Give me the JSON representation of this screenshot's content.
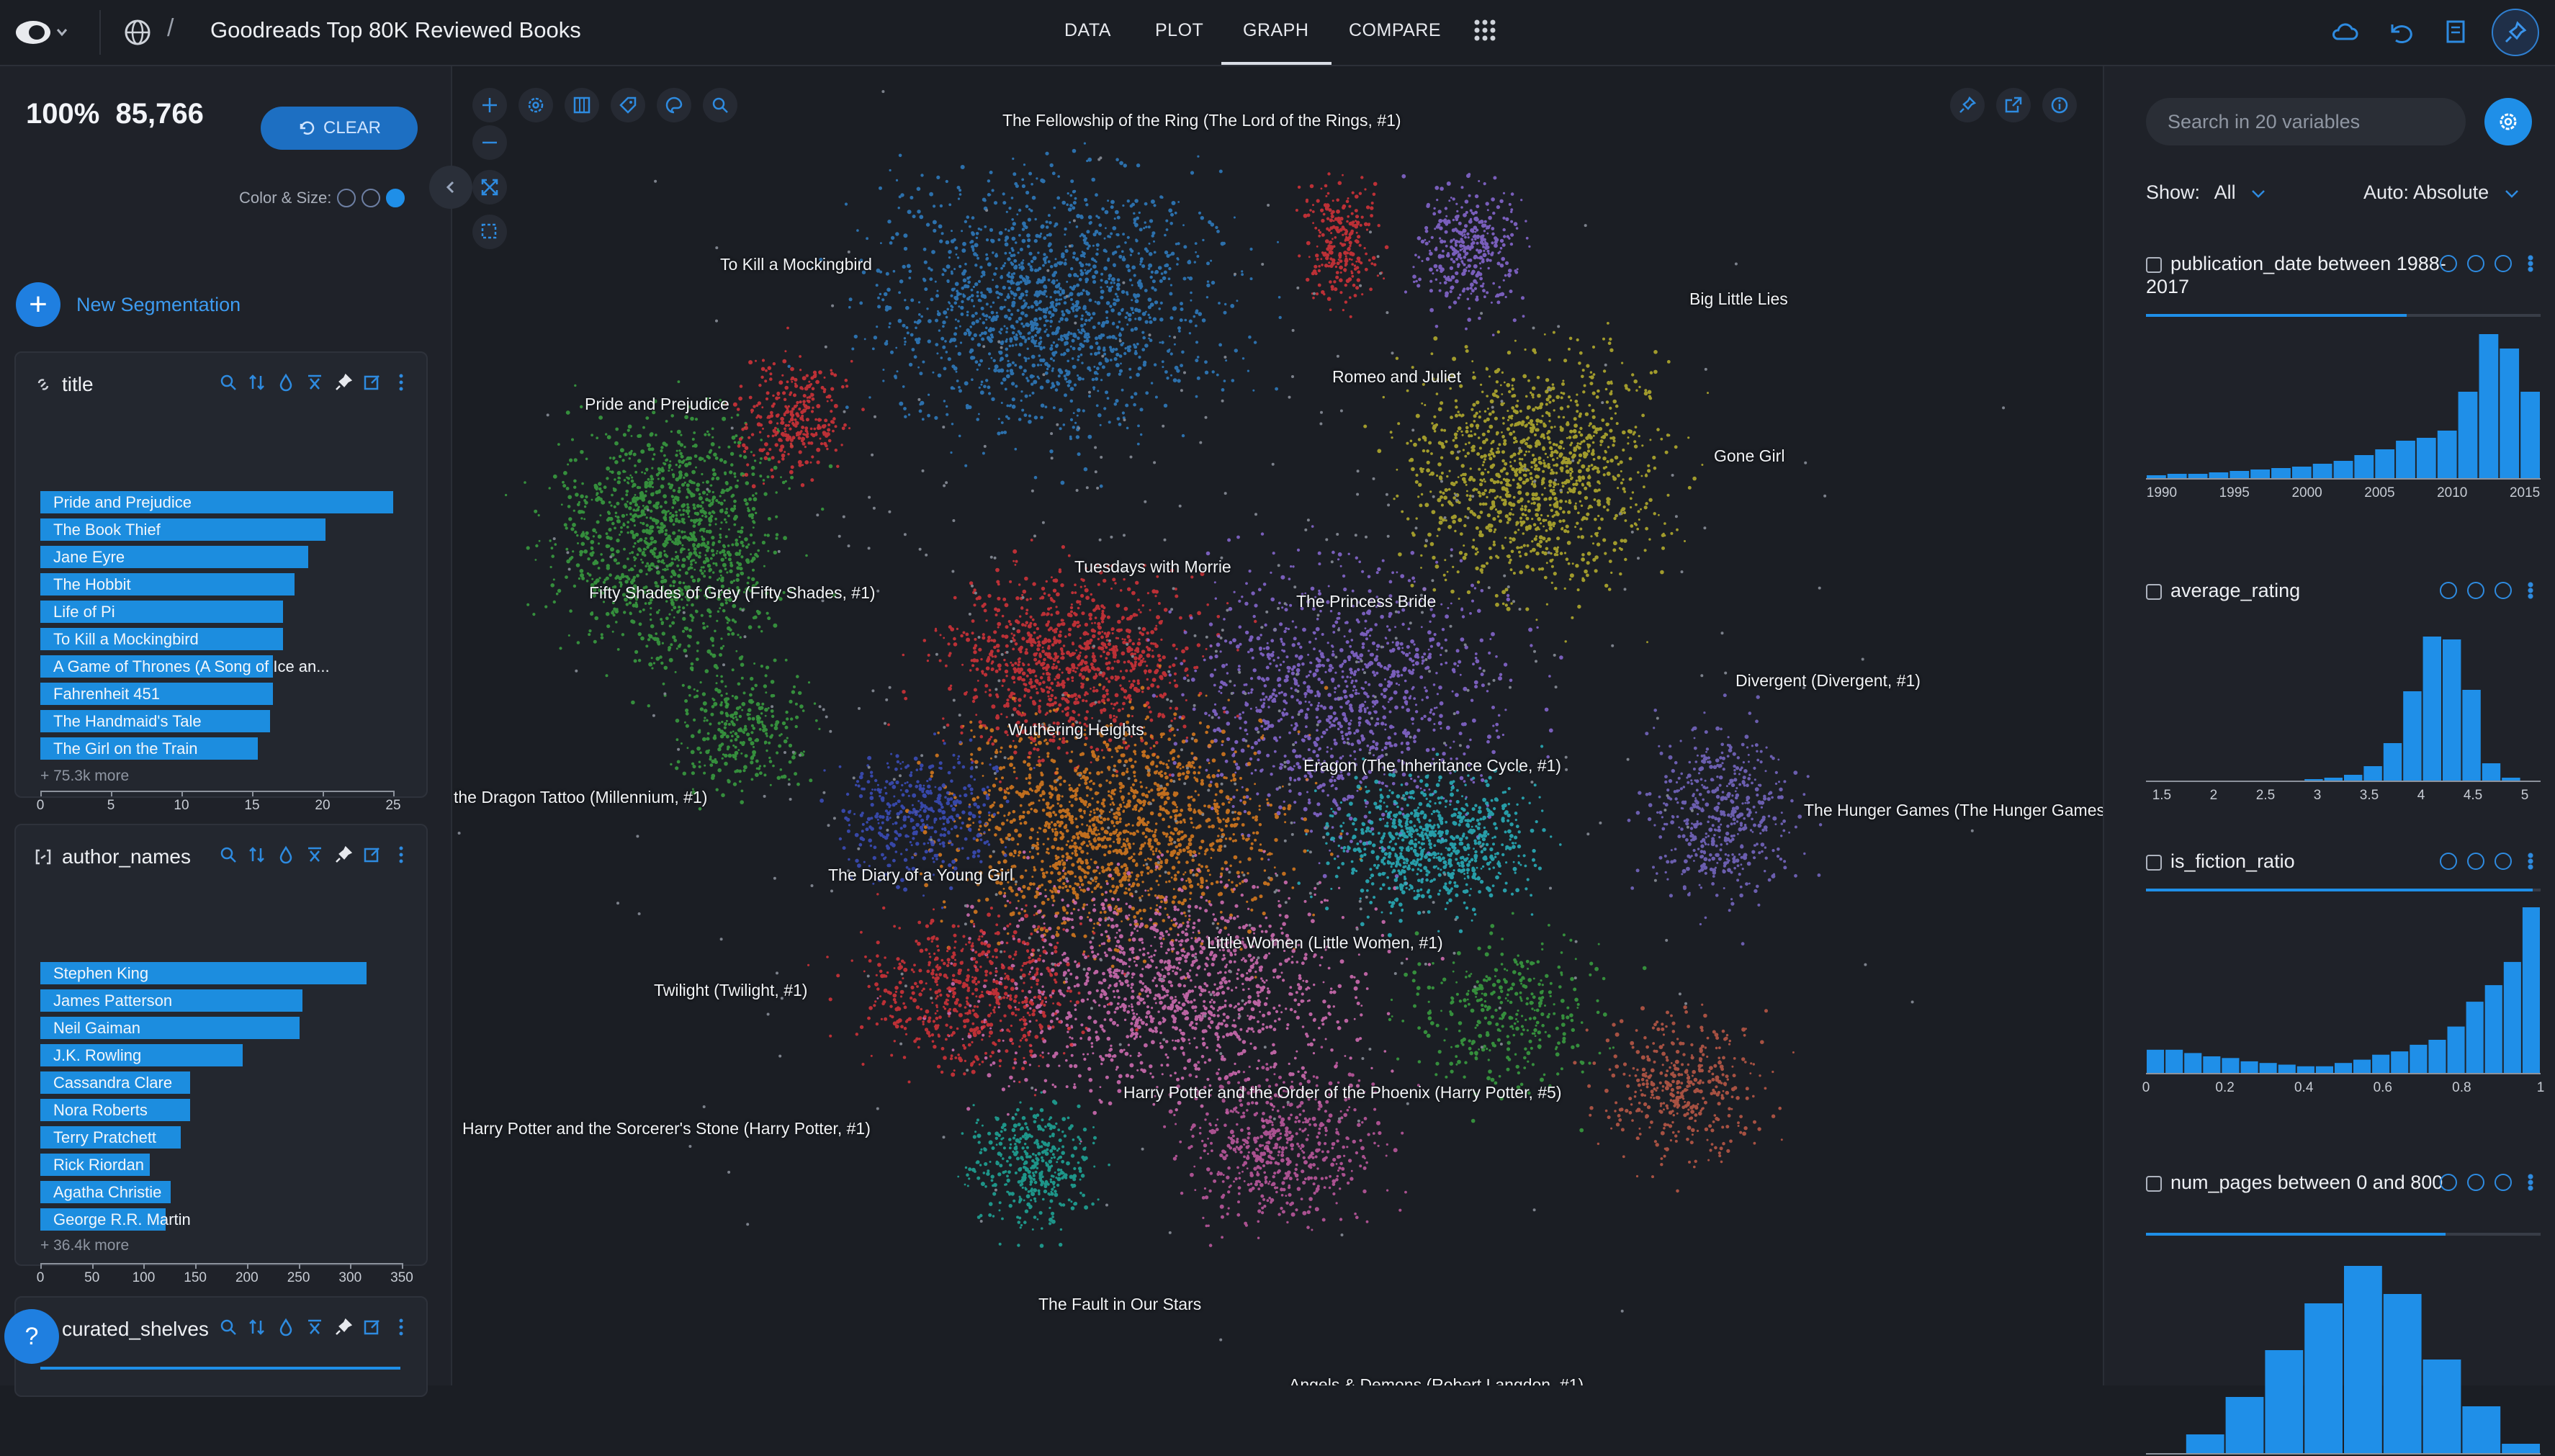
{
  "app": {
    "title": "Goodreads Top 80K Reviewed Books",
    "tabs": [
      "DATA",
      "PLOT",
      "GRAPH",
      "COMPARE"
    ],
    "active_tab": "GRAPH"
  },
  "left": {
    "percent": "100%",
    "count": "85,766",
    "clear_label": "CLEAR",
    "color_size_label": "Color & Size:",
    "new_segmentation": "New Segmentation",
    "title_card": {
      "name": "title",
      "items": [
        {
          "label": "Pride and Prejudice",
          "value": 25
        },
        {
          "label": "The Book Thief",
          "value": 20.2
        },
        {
          "label": "Jane Eyre",
          "value": 19
        },
        {
          "label": "The Hobbit",
          "value": 18
        },
        {
          "label": "Life of Pi",
          "value": 17.2
        },
        {
          "label": "To Kill a Mockingbird",
          "value": 17.2
        },
        {
          "label": "A Game of Thrones (A Song of Ice an...",
          "value": 16.5
        },
        {
          "label": "Fahrenheit 451",
          "value": 16.5
        },
        {
          "label": "The Handmaid's Tale",
          "value": 16.3
        },
        {
          "label": "The Girl on the Train",
          "value": 15.4
        }
      ],
      "more": "+ 75.3k more",
      "axis_ticks": [
        "0",
        "5",
        "10",
        "15",
        "20",
        "25"
      ],
      "axis_max": 25
    },
    "author_card": {
      "name": "author_names",
      "items": [
        {
          "label": "Stephen King",
          "value": 316
        },
        {
          "label": "James Patterson",
          "value": 254
        },
        {
          "label": "Neil Gaiman",
          "value": 251
        },
        {
          "label": "J.K. Rowling",
          "value": 196
        },
        {
          "label": "Cassandra Clare",
          "value": 145
        },
        {
          "label": "Nora Roberts",
          "value": 145
        },
        {
          "label": "Terry Pratchett",
          "value": 136
        },
        {
          "label": "Rick Riordan",
          "value": 106
        },
        {
          "label": "Agatha Christie",
          "value": 126
        },
        {
          "label": "George R.R. Martin",
          "value": 121
        }
      ],
      "more": "+ 36.4k more",
      "axis_ticks": [
        "0",
        "50",
        "100",
        "150",
        "200",
        "250",
        "300",
        "350"
      ],
      "axis_max": 350
    },
    "curated_card": {
      "name": "curated_shelves"
    },
    "help": "?"
  },
  "graph": {
    "labels": [
      "The Fellowship of the Ring (The Lord of the Rings, #1)",
      "To Kill a Mockingbird",
      "Big Little Lies",
      "Romeo and Juliet",
      "Pride and Prejudice",
      "Gone Girl",
      "Tuesdays with Morrie",
      "Fifty Shades of Grey (Fifty Shades, #1)",
      "The Princess Bride",
      "Divergent (Divergent, #1)",
      "Wuthering Heights",
      "Eragon (The Inheritance Cycle, #1)",
      "the Dragon Tattoo (Millennium, #1)",
      "The Hunger Games (The Hunger Games",
      "The Diary of a Young Girl",
      "Little Women (Little Women, #1)",
      "Twilight (Twilight, #1)",
      "Harry Potter and the Order of the Phoenix (Harry Potter, #5)",
      "Harry Potter and the Sorcerer's Stone (Harry Potter, #1)",
      "The Fault in Our Stars",
      "Angels & Demons (Robert Langdon, #1)"
    ]
  },
  "right": {
    "search_placeholder": "Search in 20 variables",
    "show_label": "Show:",
    "show_value": "All",
    "auto_label": "Auto: Absolute",
    "variables": [
      {
        "name": "publication_date between 1988-2017",
        "ticks": [
          "1990",
          "1995",
          "2000",
          "2005",
          "2010",
          "2015"
        ],
        "bins": [
          0.02,
          0.03,
          0.03,
          0.04,
          0.05,
          0.06,
          0.07,
          0.08,
          0.1,
          0.12,
          0.16,
          0.2,
          0.26,
          0.28,
          0.33,
          0.6,
          1.0,
          0.9,
          0.6
        ]
      },
      {
        "name": "average_rating",
        "ticks": [
          "1.5",
          "2",
          "2.5",
          "3",
          "3.5",
          "4",
          "4.5",
          "5"
        ],
        "bins": [
          0.0,
          0.0,
          0.0,
          0.0,
          0.0,
          0.0,
          0.0,
          0.0,
          0.01,
          0.02,
          0.04,
          0.1,
          0.26,
          0.62,
          1.0,
          0.98,
          0.63,
          0.12,
          0.02,
          0.0
        ]
      },
      {
        "name": "is_fiction_ratio",
        "ticks": [
          "0",
          "0.2",
          "0.4",
          "0.6",
          "0.8",
          "1"
        ],
        "bins": [
          0.14,
          0.14,
          0.12,
          0.1,
          0.09,
          0.07,
          0.06,
          0.05,
          0.04,
          0.04,
          0.06,
          0.08,
          0.11,
          0.13,
          0.17,
          0.2,
          0.28,
          0.43,
          0.53,
          0.67,
          1.0
        ]
      },
      {
        "name": "num_pages between 0 and 800",
        "ticks": [],
        "bins": [
          0.0,
          0.1,
          0.3,
          0.55,
          0.8,
          1.0,
          0.85,
          0.5,
          0.25,
          0.05
        ]
      }
    ]
  }
}
